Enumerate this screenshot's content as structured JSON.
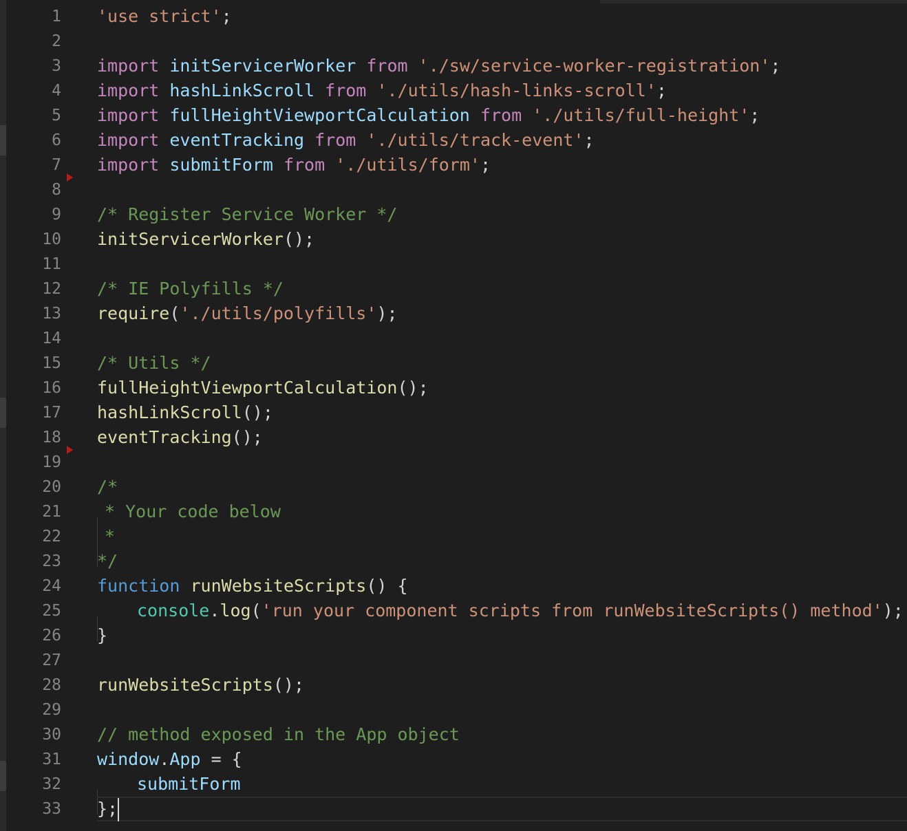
{
  "colors": {
    "background": "#1e1e1e",
    "line_number": "#858585",
    "string": "#ce9178",
    "keyword": "#c586c0",
    "variable": "#9cdcfe",
    "function": "#dcdcaa",
    "comment": "#6a9955",
    "storage": "#569cd6",
    "class": "#4ec9b0",
    "punctuation": "#d4d4d4"
  },
  "editor": {
    "current_line": 33,
    "line_numbers": [
      "1",
      "2",
      "3",
      "4",
      "5",
      "6",
      "7",
      "8",
      "9",
      "10",
      "11",
      "12",
      "13",
      "14",
      "15",
      "16",
      "17",
      "18",
      "19",
      "20",
      "21",
      "22",
      "23",
      "24",
      "25",
      "26",
      "27",
      "28",
      "29",
      "30",
      "31",
      "32",
      "33"
    ],
    "lines": [
      [
        {
          "t": "str",
          "v": "'use strict'"
        },
        {
          "t": "p",
          "v": ";"
        }
      ],
      [],
      [
        {
          "t": "kw",
          "v": "import"
        },
        {
          "t": "p",
          "v": " "
        },
        {
          "t": "id",
          "v": "initServicerWorker"
        },
        {
          "t": "p",
          "v": " "
        },
        {
          "t": "kw",
          "v": "from"
        },
        {
          "t": "p",
          "v": " "
        },
        {
          "t": "str",
          "v": "'./sw/service-worker-registration'"
        },
        {
          "t": "p",
          "v": ";"
        }
      ],
      [
        {
          "t": "kw",
          "v": "import"
        },
        {
          "t": "p",
          "v": " "
        },
        {
          "t": "id",
          "v": "hashLinkScroll"
        },
        {
          "t": "p",
          "v": " "
        },
        {
          "t": "kw",
          "v": "from"
        },
        {
          "t": "p",
          "v": " "
        },
        {
          "t": "str",
          "v": "'./utils/hash-links-scroll'"
        },
        {
          "t": "p",
          "v": ";"
        }
      ],
      [
        {
          "t": "kw",
          "v": "import"
        },
        {
          "t": "p",
          "v": " "
        },
        {
          "t": "id",
          "v": "fullHeightViewportCalculation"
        },
        {
          "t": "p",
          "v": " "
        },
        {
          "t": "kw",
          "v": "from"
        },
        {
          "t": "p",
          "v": " "
        },
        {
          "t": "str",
          "v": "'./utils/full-height'"
        },
        {
          "t": "p",
          "v": ";"
        }
      ],
      [
        {
          "t": "kw",
          "v": "import"
        },
        {
          "t": "p",
          "v": " "
        },
        {
          "t": "id",
          "v": "eventTracking"
        },
        {
          "t": "p",
          "v": " "
        },
        {
          "t": "kw",
          "v": "from"
        },
        {
          "t": "p",
          "v": " "
        },
        {
          "t": "str",
          "v": "'./utils/track-event'"
        },
        {
          "t": "p",
          "v": ";"
        }
      ],
      [
        {
          "t": "kw",
          "v": "import"
        },
        {
          "t": "p",
          "v": " "
        },
        {
          "t": "id",
          "v": "submitForm"
        },
        {
          "t": "p",
          "v": " "
        },
        {
          "t": "kw",
          "v": "from"
        },
        {
          "t": "p",
          "v": " "
        },
        {
          "t": "str",
          "v": "'./utils/form'"
        },
        {
          "t": "p",
          "v": ";"
        }
      ],
      [],
      [
        {
          "t": "cmt",
          "v": "/* Register Service Worker */"
        }
      ],
      [
        {
          "t": "fn",
          "v": "initServicerWorker"
        },
        {
          "t": "p",
          "v": "();"
        }
      ],
      [],
      [
        {
          "t": "cmt",
          "v": "/* IE Polyfills */"
        }
      ],
      [
        {
          "t": "fn",
          "v": "require"
        },
        {
          "t": "p",
          "v": "("
        },
        {
          "t": "str",
          "v": "'./utils/polyfills'"
        },
        {
          "t": "p",
          "v": ");"
        }
      ],
      [],
      [
        {
          "t": "cmt",
          "v": "/* Utils */"
        }
      ],
      [
        {
          "t": "fn",
          "v": "fullHeightViewportCalculation"
        },
        {
          "t": "p",
          "v": "();"
        }
      ],
      [
        {
          "t": "fn",
          "v": "hashLinkScroll"
        },
        {
          "t": "p",
          "v": "();"
        }
      ],
      [
        {
          "t": "fn",
          "v": "eventTracking"
        },
        {
          "t": "p",
          "v": "();"
        }
      ],
      [],
      [
        {
          "t": "cmt",
          "v": "/*"
        }
      ],
      [
        {
          "t": "cguide"
        },
        {
          "t": "cmt",
          "v": "* Your code below"
        }
      ],
      [
        {
          "t": "cguide"
        },
        {
          "t": "cmt",
          "v": "*"
        }
      ],
      [
        {
          "t": "cmt",
          "v": "*/"
        }
      ],
      [
        {
          "t": "blue",
          "v": "function"
        },
        {
          "t": "p",
          "v": " "
        },
        {
          "t": "fn",
          "v": "runWebsiteScripts"
        },
        {
          "t": "p",
          "v": "() {"
        }
      ],
      [
        {
          "t": "indent"
        },
        {
          "t": "cls",
          "v": "console"
        },
        {
          "t": "p",
          "v": "."
        },
        {
          "t": "fn",
          "v": "log"
        },
        {
          "t": "p",
          "v": "("
        },
        {
          "t": "str",
          "v": "'run your component scripts from runWebsiteScripts() method'"
        },
        {
          "t": "p",
          "v": ");"
        }
      ],
      [
        {
          "t": "p",
          "v": "}"
        }
      ],
      [],
      [
        {
          "t": "fn",
          "v": "runWebsiteScripts"
        },
        {
          "t": "p",
          "v": "();"
        }
      ],
      [],
      [
        {
          "t": "cmt",
          "v": "// method exposed in the App object"
        }
      ],
      [
        {
          "t": "id",
          "v": "window"
        },
        {
          "t": "p",
          "v": "."
        },
        {
          "t": "id",
          "v": "App"
        },
        {
          "t": "p",
          "v": " = {"
        }
      ],
      [
        {
          "t": "indent"
        },
        {
          "t": "id",
          "v": "submitForm"
        }
      ],
      [
        {
          "t": "p",
          "v": "};"
        },
        {
          "t": "cursor"
        }
      ]
    ]
  }
}
